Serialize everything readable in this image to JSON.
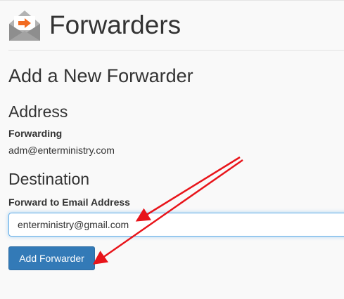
{
  "header": {
    "title": "Forwarders",
    "icon": "envelope-forward-icon"
  },
  "form": {
    "section_title": "Add a New Forwarder",
    "address": {
      "heading": "Address",
      "label": "Forwarding",
      "value": "adm@enterministry.com"
    },
    "destination": {
      "heading": "Destination",
      "label": "Forward to Email Address",
      "value": "enterministry@gmail.com"
    },
    "submit_label": "Add Forwarder"
  },
  "colors": {
    "button": "#337ab7",
    "input_focus": "#66afe9",
    "annotation_arrow": "#e8141a",
    "icon_arrow": "#f26b21"
  }
}
